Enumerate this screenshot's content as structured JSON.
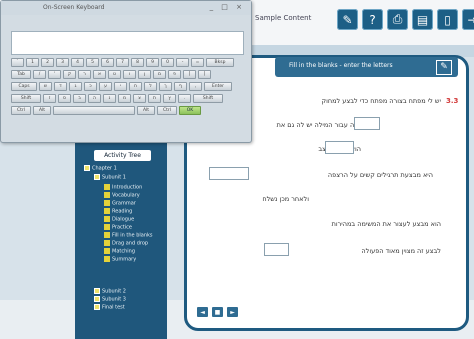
{
  "app": {
    "title": "Sample Content"
  },
  "toolbar": {
    "buttons": [
      {
        "name": "tools-icon",
        "glyph": "✎"
      },
      {
        "name": "help-icon",
        "glyph": "?"
      },
      {
        "name": "print-icon",
        "glyph": "⎙"
      },
      {
        "name": "notebook-icon",
        "glyph": "▤"
      },
      {
        "name": "device-icon",
        "glyph": "▯"
      },
      {
        "name": "exit-icon",
        "glyph": "⇥"
      }
    ]
  },
  "panel": {
    "header_text": "Fill in the blanks - enter the letters",
    "edit_glyph": "✎",
    "question_number": "3.3",
    "rows": [
      "יש לי מפתח  בצורה מפתח  כדי לבצע למחוק",
      "המילה  עבור המילה  יש לה גם את",
      "הוא מבצע  מצב",
      "היא מבצעת  תרגילים  קשים על הרצפה",
      "ולאחר מכן  נשלח",
      "הוא מבצע לעצור  את  המשימה  במהירות",
      "לבצע זה מצוין  מאוד  הפעולה"
    ]
  },
  "pager": {
    "buttons": [
      "◄",
      "■",
      "►"
    ]
  },
  "sidebar": {
    "tree_button_label": "Activity Tree",
    "chapter_label": "Chapter 1",
    "subunit_open_label": "Subunit 1",
    "leaf_items": [
      "Introduction",
      "Vocabulary",
      "Grammar",
      "Reading",
      "Dialogue",
      "Practice",
      "Fill in the blanks",
      "Drag and drop",
      "Matching",
      "Summary"
    ],
    "collapsed_items": [
      "Subunit 2",
      "Subunit 3",
      "Final test"
    ]
  },
  "keyboard": {
    "title": "On-Screen Keyboard",
    "controls": "_ □ ×",
    "rows": [
      [
        "`",
        "1",
        "2",
        "3",
        "4",
        "5",
        "6",
        "7",
        "8",
        "9",
        "0",
        "-",
        "=",
        "Bksp"
      ],
      [
        "Tab",
        "/",
        "'",
        "ק",
        "ר",
        "א",
        "ט",
        "ו",
        "ן",
        "ם",
        "פ",
        "]",
        "["
      ],
      [
        "Caps",
        "ש",
        "ד",
        "ג",
        "כ",
        "ע",
        "י",
        "ח",
        "ל",
        "ך",
        "ף",
        ",",
        "Enter"
      ],
      [
        "Shift",
        "ז",
        "ס",
        "ב",
        "ה",
        "נ",
        "מ",
        "צ",
        "ת",
        "ץ",
        ".",
        "Shift"
      ],
      [
        "Ctrl",
        "Alt",
        "",
        "Alt",
        "Ctrl",
        "OK"
      ]
    ]
  }
}
